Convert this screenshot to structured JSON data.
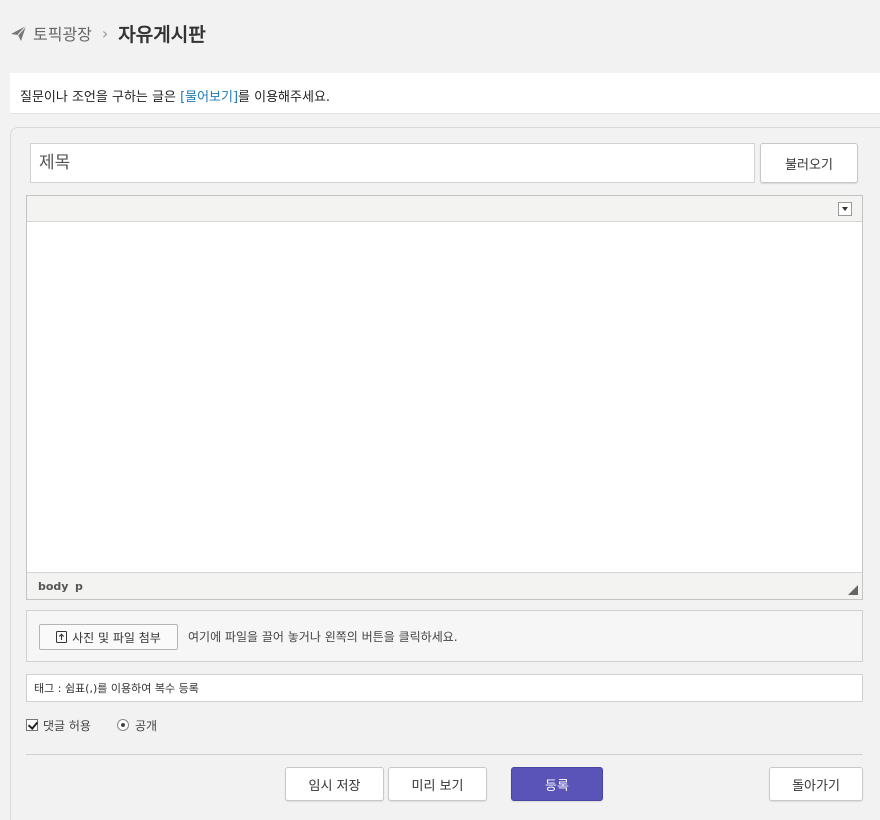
{
  "breadcrumb": {
    "parent": "토픽광장",
    "separator": "›",
    "current": "자유게시판"
  },
  "notice": {
    "before": "질문이나 조언을 구하는 글은 ",
    "link": "[물어보기]",
    "after": "를 이용해주세요.",
    "link_color": "#1f7ab8"
  },
  "title_field": {
    "placeholder": "제목",
    "load_label": "불러오기"
  },
  "editor": {
    "status_path": [
      "body",
      "p"
    ]
  },
  "attach": {
    "button_label": "사진 및 파일 첨부",
    "hint": "여기에 파일을 끌어 놓거나 왼쪽의 버튼을 클릭하세요."
  },
  "tag_field": {
    "placeholder": "태그 : 쉼표(,)를 이용하여 복수 등록"
  },
  "options": {
    "allow_comments_label": "댓글 허용",
    "allow_comments_checked": true,
    "public_label": "공개",
    "public_selected": true
  },
  "actions": {
    "draft_label": "임시 저장",
    "preview_label": "미리 보기",
    "submit_label": "등록",
    "back_label": "돌아가기",
    "submit_color": "#5a53b8"
  }
}
